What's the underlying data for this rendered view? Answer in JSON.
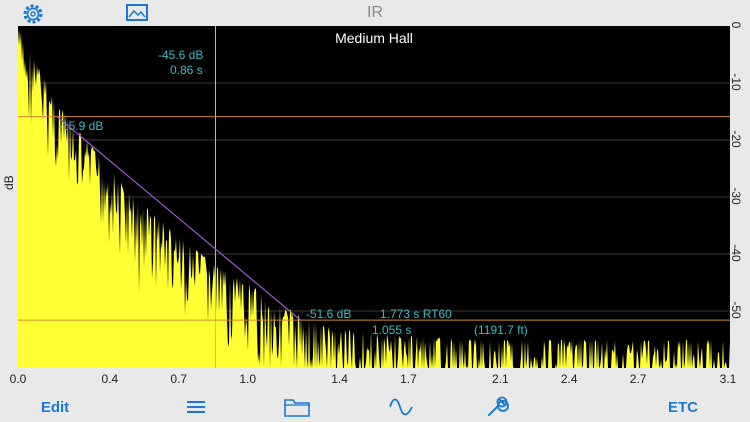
{
  "header": {
    "title": "IR",
    "settings_icon": "gear-icon",
    "image_icon": "image-icon"
  },
  "chart_data": {
    "type": "area",
    "title": "Medium Hall",
    "ylabel": "dB",
    "xlim": [
      0.0,
      3.1
    ],
    "ylim": [
      -60,
      0
    ],
    "x_ticks": [
      "0.0",
      "0.4",
      "0.7",
      "1.0",
      "1.4",
      "1.7",
      "2.1",
      "2.4",
      "2.7",
      "3.1"
    ],
    "y_ticks": [
      "0",
      "-10",
      "-20",
      "-30",
      "-40",
      "-50"
    ],
    "grid": true,
    "fill_color": "#ffff33",
    "background": "#000000",
    "cursor": {
      "x": 0.86,
      "db": "-45.6 dB",
      "time": "0.86 s"
    },
    "upper_marker": {
      "db": -15.9,
      "label": "-15.9 dB",
      "x": 0.17
    },
    "lower_marker": {
      "db": -51.6,
      "label": "-51.6 dB",
      "x": 1.23
    },
    "rt60": {
      "value": "1.773 s RT60",
      "time": "1.055 s",
      "distance": "(1191.7 ft)"
    },
    "decay_envelope": [
      [
        0.0,
        -2
      ],
      [
        0.05,
        -6
      ],
      [
        0.1,
        -10
      ],
      [
        0.2,
        -17
      ],
      [
        0.3,
        -22
      ],
      [
        0.4,
        -27
      ],
      [
        0.5,
        -32
      ],
      [
        0.6,
        -35
      ],
      [
        0.7,
        -39
      ],
      [
        0.8,
        -42
      ],
      [
        0.9,
        -45
      ],
      [
        1.0,
        -47
      ],
      [
        1.1,
        -50
      ],
      [
        1.2,
        -52
      ],
      [
        1.3,
        -54
      ],
      [
        1.4,
        -55
      ],
      [
        1.6,
        -56
      ],
      [
        1.8,
        -56.5
      ],
      [
        2.0,
        -57
      ],
      [
        2.4,
        -57
      ],
      [
        2.8,
        -57
      ],
      [
        3.1,
        -57
      ]
    ]
  },
  "toolbar": {
    "edit_label": "Edit",
    "etc_label": "ETC",
    "list_icon": "list-icon",
    "folder_icon": "folder-icon",
    "wave_icon": "sine-wave-icon",
    "wrench_icon": "wrench-icon"
  },
  "colors": {
    "accent": "#1a78d6",
    "annotation": "#3fb9c4",
    "marker_line": "#d08a2a",
    "fit_line": "#9b5bd1"
  }
}
